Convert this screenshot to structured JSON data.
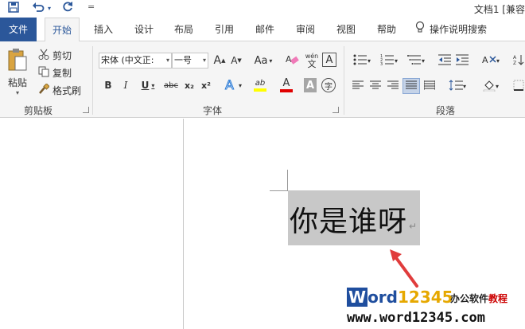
{
  "window": {
    "title": "文档1 [兼容"
  },
  "quick_access": {
    "save_icon": "save-icon",
    "undo_icon": "undo-icon",
    "redo_icon": "redo-icon",
    "customize": "="
  },
  "tabs": [
    {
      "label": "文件"
    },
    {
      "label": "开始"
    },
    {
      "label": "插入"
    },
    {
      "label": "设计"
    },
    {
      "label": "布局"
    },
    {
      "label": "引用"
    },
    {
      "label": "邮件"
    },
    {
      "label": "审阅"
    },
    {
      "label": "视图"
    },
    {
      "label": "帮助"
    }
  ],
  "tell_me": {
    "label": "操作说明搜索"
  },
  "clipboard": {
    "paste": "粘贴",
    "cut": "剪切",
    "copy": "复制",
    "format_painter": "格式刷",
    "group_label": "剪贴板"
  },
  "font": {
    "font_name": "宋体 (中文正:",
    "font_size": "一号",
    "bold": "B",
    "italic": "I",
    "underline": "U",
    "strike": "abc",
    "subscript": "x₂",
    "superscript": "x²",
    "highlight": "ab",
    "font_color": "A",
    "shading": "A",
    "enclose": "字",
    "grow": "A",
    "shrink": "A",
    "case": "Aa",
    "phonetic_top": "wén",
    "phonetic_bottom": "文",
    "border_char": "A",
    "group_label": "字体"
  },
  "paragraph": {
    "group_label": "段落"
  },
  "document": {
    "text": "你是谁呀",
    "para_mark": "↵"
  },
  "watermark": {
    "w": "W",
    "ord": "ord",
    "num": "12345",
    "sub1": "办公软件",
    "sub2": "教程",
    "url": "www.word12345.com"
  },
  "colors": {
    "accent": "#2b579a",
    "highlight_yellow": "#ffff00",
    "font_red": "#e00000",
    "arrow_red": "#e03c3c",
    "selection": "#c8c8c8"
  }
}
